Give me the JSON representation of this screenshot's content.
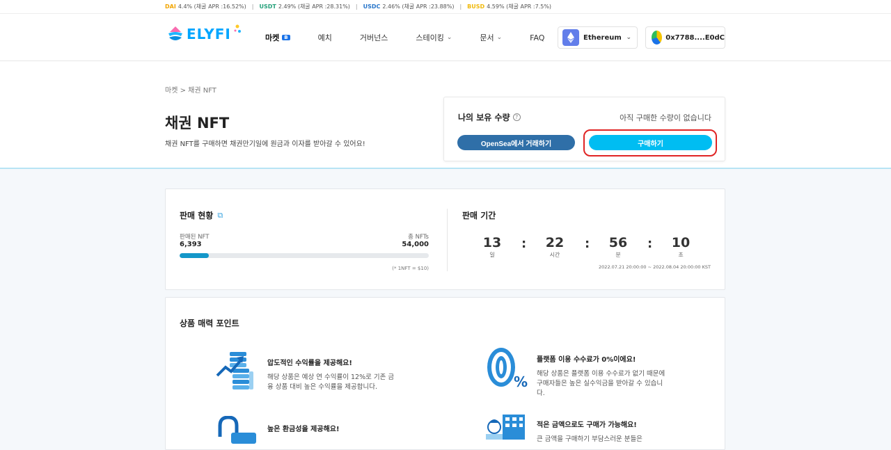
{
  "ticker": [
    {
      "symbol": "DAI",
      "text": "4.4% (채굴 APR :16.52%)",
      "color": "#f2a500"
    },
    {
      "symbol": "USDT",
      "text": "2.49% (채굴 APR :28.31%)",
      "color": "#26a17b"
    },
    {
      "symbol": "USDC",
      "text": "2.46% (채굴 APR :23.88%)",
      "color": "#2775ca"
    },
    {
      "symbol": "BUSD",
      "text": "4.59% (채굴 APR :7.5%)",
      "color": "#f0b90b"
    }
  ],
  "header": {
    "logo_text": "ELYFI",
    "nav": [
      {
        "label": "마켓",
        "badge": "B"
      },
      {
        "label": "예치"
      },
      {
        "label": "거버넌스"
      },
      {
        "label": "스테이킹",
        "chevron": true
      },
      {
        "label": "문서",
        "chevron": true
      },
      {
        "label": "FAQ"
      }
    ],
    "network": "Ethereum",
    "wallet": "0x7788....E0dC"
  },
  "hero": {
    "breadcrumb": "마켓 > 채권 NFT",
    "title": "채권 NFT",
    "description": "채권 NFT를 구매하면 채권만기일에 원금과 이자를 받아갈 수 있어요!"
  },
  "holding": {
    "title": "나의 보유 수량",
    "help": "?",
    "status": "아직 구매한 수량이 없습니다",
    "opensea_label": "OpenSea에서 거래하기",
    "buy_label": "구매하기"
  },
  "sales": {
    "title": "판매 현황",
    "sold_label": "판매된 NFT",
    "sold_value": "6,393",
    "total_label": "총 NFTs",
    "total_value": "54,000",
    "progress_fraction": 0.118,
    "note": "(* 1NFT = $10)",
    "period_title": "판매 기간",
    "countdown": [
      {
        "value": "13",
        "label": "일"
      },
      {
        "value": "22",
        "label": "시간"
      },
      {
        "value": "56",
        "label": "분"
      },
      {
        "value": "10",
        "label": "초"
      }
    ],
    "period_range": "2022.07.21 20:00:00 ~ 2022.08.04 20:00:00 KST"
  },
  "points": {
    "title": "상품 매력 포인트",
    "features": [
      {
        "title": "압도적인 수익률을 제공해요!",
        "desc": "해당 상품은 예상 연 수익률이 12%로 기존 금융 상품 대비 높은 수익률을 제공합니다."
      },
      {
        "title": "플랫폼 이용 수수료가 0%이에요!",
        "desc": "해당 상품은 플랫폼 이용 수수료가 없기 때문에 구매자들은 높은 실수익금을 받아갈 수 있습니다."
      },
      {
        "title": "높은 환금성을 제공해요!",
        "desc": ""
      },
      {
        "title": "적은 금액으로도 구매가 가능해요!",
        "desc": "큰 금액을 구매하기 부담스러운 분들은"
      }
    ]
  }
}
